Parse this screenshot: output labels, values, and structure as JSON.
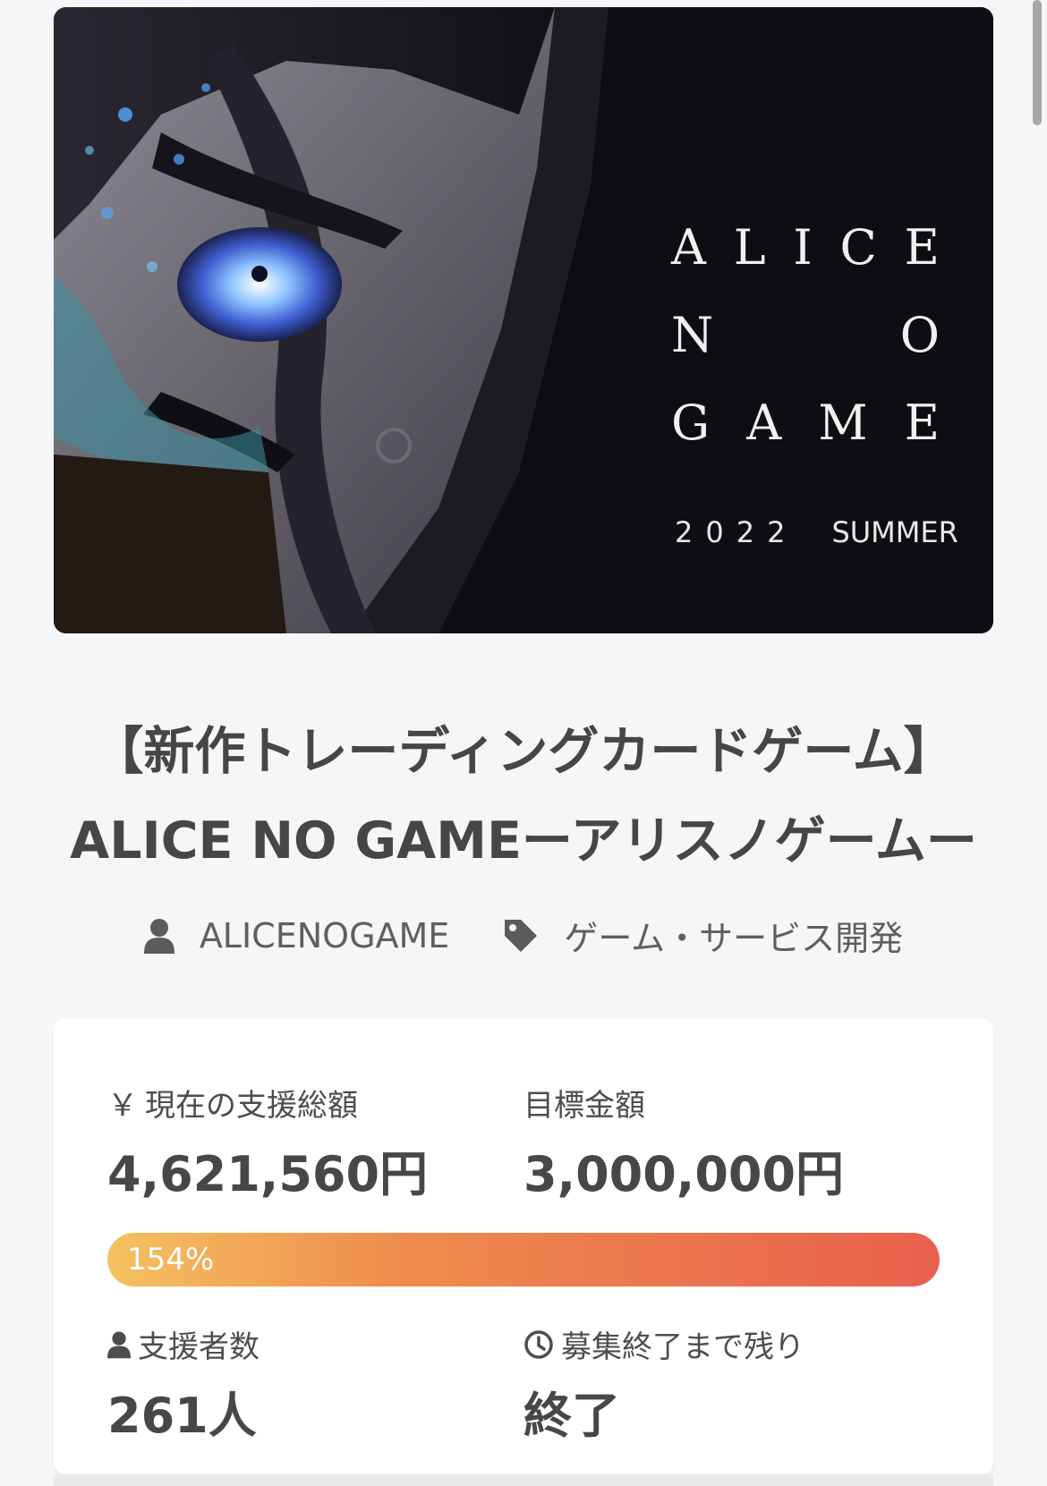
{
  "hero": {
    "title_lines": [
      [
        "A",
        "L",
        "I",
        "C",
        "E"
      ],
      [
        "N",
        "O"
      ],
      [
        "G",
        "A",
        "M",
        "E"
      ]
    ],
    "year": "2022",
    "season": "SUMMER"
  },
  "project": {
    "title_line1": "【新作トレーディングカードゲーム】",
    "title_line2": "ALICE NO GAMEーアリスノゲームー",
    "owner": "ALICENOGAME",
    "category": "ゲーム・サービス開発"
  },
  "stats": {
    "current_label": "現在の支援総額",
    "current_value": "4,621,560円",
    "goal_label": "目標金額",
    "goal_value": "3,000,000円",
    "progress_percent": 154,
    "progress_text": "154%",
    "backers_label": "支援者数",
    "backers_value": "261人",
    "remaining_label": "募集終了まで残り",
    "remaining_value": "終了"
  },
  "icons": {
    "yen": "￥",
    "user": "user-icon",
    "tag": "tag-icon",
    "clock": "clock-icon"
  },
  "colors": {
    "progress_start": "#f5c160",
    "progress_end": "#e9604e"
  }
}
